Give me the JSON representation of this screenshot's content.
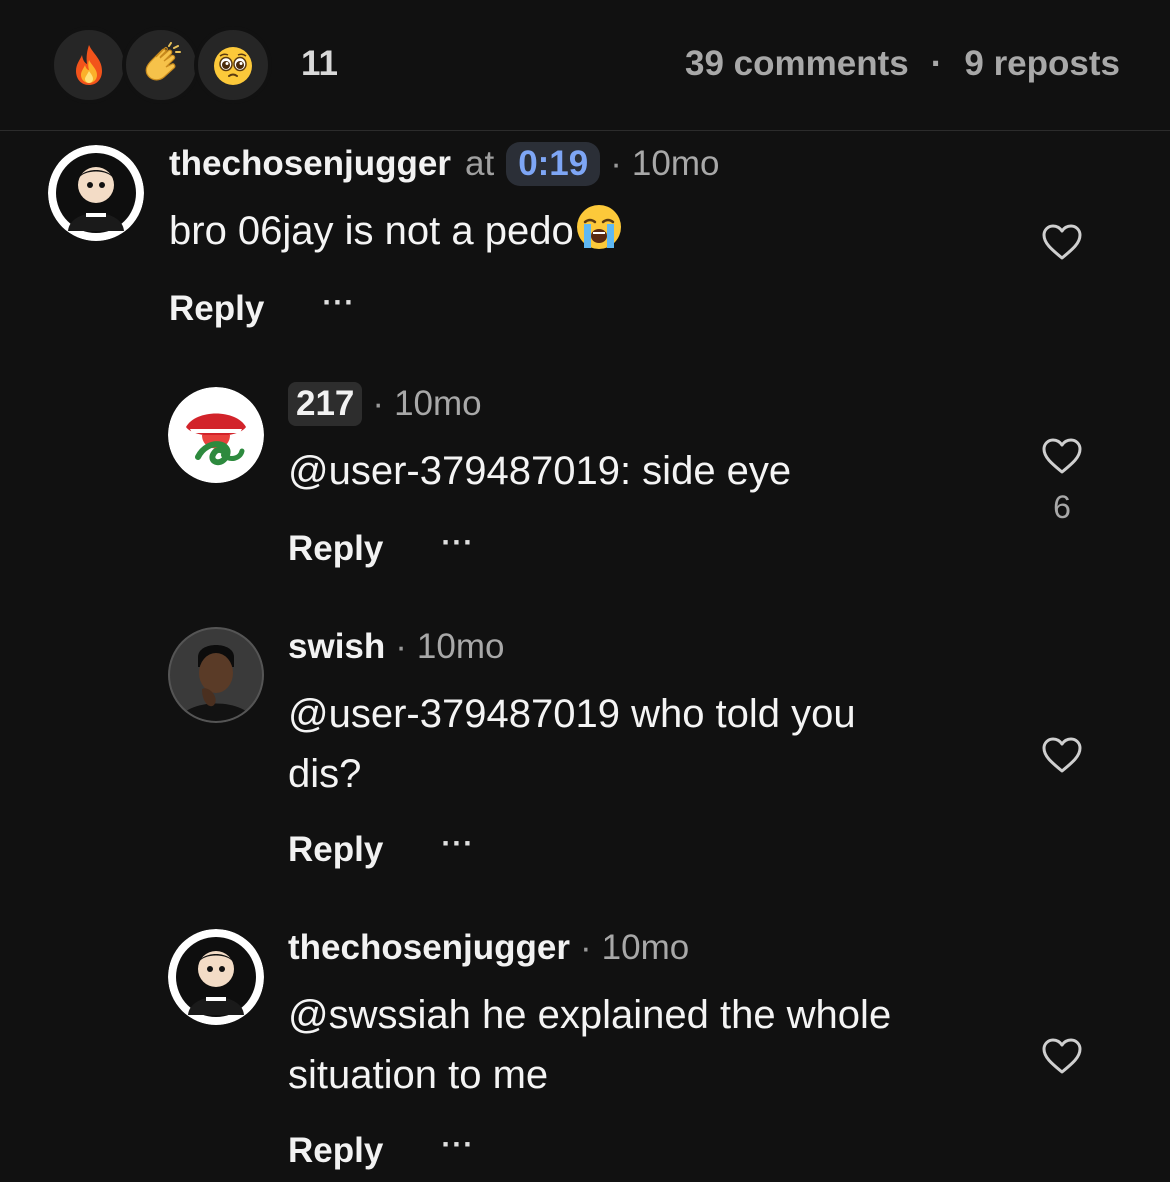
{
  "stats": {
    "reactions": [
      {
        "icon": "fire-icon"
      },
      {
        "icon": "clapping-hands-icon"
      },
      {
        "icon": "pleading-face-icon"
      }
    ],
    "reaction_count": "11",
    "comments_label": "39 comments",
    "separator": "·",
    "reposts_label": "9 reposts"
  },
  "comments": [
    {
      "username": "thechosenjugger",
      "at_word": "at",
      "timestamp": "0:19",
      "separator": "·",
      "time": "10mo",
      "text": "bro 06jay is not a pedo",
      "emoji": "loudly-crying-face-icon",
      "reply_label": "Reply",
      "more_label": "···",
      "like_count": "",
      "avatar": "cartoon-character-avatar"
    },
    {
      "username": "217",
      "separator": "·",
      "time": "10mo",
      "text": "@user-379487019: side eye",
      "reply_label": "Reply",
      "more_label": "···",
      "like_count": "6",
      "avatar": "tongue-snake-logo-avatar"
    },
    {
      "username": "swish",
      "separator": "·",
      "time": "10mo",
      "text": "@user-379487019 who told you dis?",
      "reply_label": "Reply",
      "more_label": "···",
      "like_count": "",
      "avatar": "person-photo-avatar"
    },
    {
      "username": "thechosenjugger",
      "separator": "·",
      "time": "10mo",
      "text": "@swssiah he explained the whole situation to me",
      "reply_label": "Reply",
      "more_label": "···",
      "like_count": "",
      "avatar": "cartoon-character-avatar"
    }
  ],
  "colors": {
    "background": "#111111",
    "accent_timestamp": "#7ea6f5",
    "secondary_text": "#a0a0a0"
  }
}
